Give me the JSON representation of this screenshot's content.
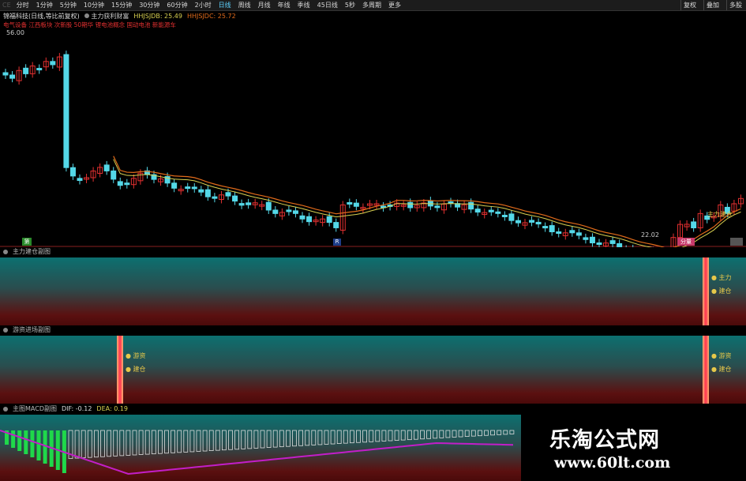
{
  "toolbar": {
    "periods": [
      "分时",
      "1分钟",
      "5分钟",
      "10分钟",
      "15分钟",
      "30分钟",
      "60分钟",
      "2小时",
      "日线",
      "周线",
      "月线",
      "年线",
      "季线",
      "45日线",
      "5秒",
      "多周期",
      "更多"
    ],
    "active_period": "日线",
    "right_tools": [
      "复权",
      "叠加",
      "多股"
    ],
    "left_marker": "CE"
  },
  "info": {
    "stock_name": "锦福科技(日线,等比前复权)",
    "indicator_name": "主力获利财富",
    "hhjsjdb_label": "HHJSJDB: 25.49",
    "hhjsjdc_label": "HHJSJDC: 25.72",
    "sectors": "电气设备 江西板块 次新股 50期华 锂电池概念 国动电池 新能源车"
  },
  "main_chart": {
    "price_high_label": "56.00",
    "price_low_label": "22.02",
    "signal_label": "主力建仓",
    "left_badge": "第",
    "mid_badge": "R",
    "right_badge": "分量"
  },
  "panel1": {
    "title": "主力建仓副图",
    "signal_main": "主力",
    "signal_build": "建仓"
  },
  "panel2": {
    "title": "游资进场副图",
    "signal_left_a": "游资",
    "signal_left_b": "建仓",
    "signal_right_a": "游资",
    "signal_right_b": "建仓"
  },
  "panel3": {
    "title": "主图MACD副图",
    "dif_label": "DIF: -0.12",
    "dea_label": "DEA: 0.19"
  },
  "watermark": {
    "title": "乐淘公式网",
    "url": "www.60lt.com"
  },
  "colors": {
    "up": "#e23030",
    "down": "#54d8e8",
    "ma_orange": "#e06a1a",
    "ma_yellow": "#d8d050",
    "macd_purple": "#c21ec8",
    "macd_green": "#1fd84a",
    "signal_bar": "#ff4050"
  }
}
